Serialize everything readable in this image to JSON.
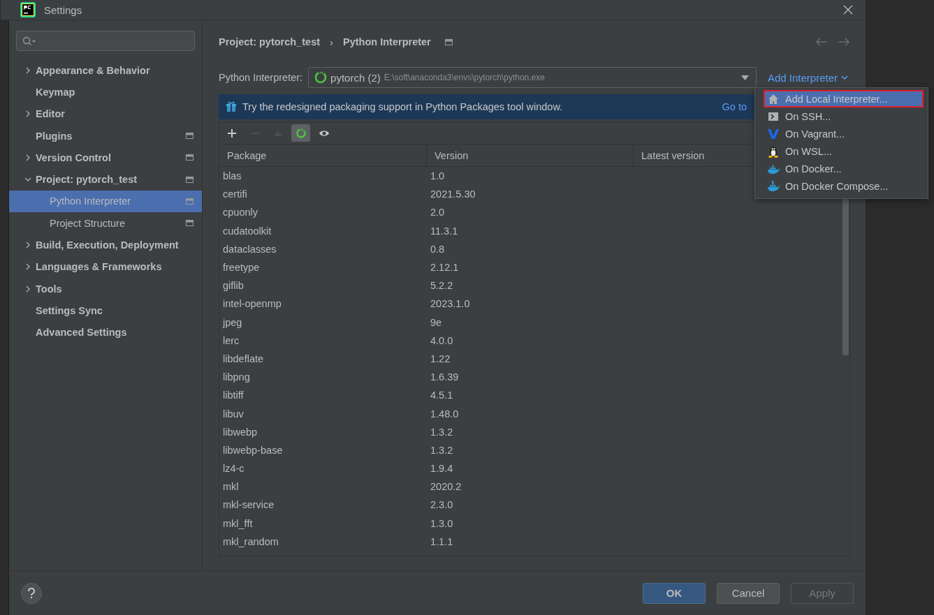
{
  "window": {
    "title": "Settings"
  },
  "sidebar": {
    "items": [
      {
        "label": "Appearance & Behavior",
        "kind": "group",
        "expanded": false,
        "selected": false,
        "project_scope": false
      },
      {
        "label": "Keymap",
        "kind": "leaf",
        "selected": false,
        "project_scope": false
      },
      {
        "label": "Editor",
        "kind": "group",
        "expanded": false,
        "selected": false,
        "project_scope": false
      },
      {
        "label": "Plugins",
        "kind": "leaf",
        "selected": false,
        "project_scope": true
      },
      {
        "label": "Version Control",
        "kind": "group",
        "expanded": false,
        "selected": false,
        "project_scope": true
      },
      {
        "label": "Project: pytorch_test",
        "kind": "group",
        "expanded": true,
        "selected": false,
        "project_scope": true,
        "children": [
          {
            "label": "Python Interpreter",
            "selected": true,
            "project_scope": true
          },
          {
            "label": "Project Structure",
            "selected": false,
            "project_scope": true
          }
        ]
      },
      {
        "label": "Build, Execution, Deployment",
        "kind": "group",
        "expanded": false,
        "selected": false,
        "project_scope": false
      },
      {
        "label": "Languages & Frameworks",
        "kind": "group",
        "expanded": false,
        "selected": false,
        "project_scope": false
      },
      {
        "label": "Tools",
        "kind": "group",
        "expanded": false,
        "selected": false,
        "project_scope": false
      },
      {
        "label": "Settings Sync",
        "kind": "leaf",
        "selected": false,
        "project_scope": false
      },
      {
        "label": "Advanced Settings",
        "kind": "leaf",
        "selected": false,
        "project_scope": false
      }
    ]
  },
  "breadcrumb": [
    "Project: pytorch_test",
    "Python Interpreter"
  ],
  "breadcrumb_separator": "›",
  "interpreter": {
    "label": "Python Interpreter:",
    "name": "pytorch (2)",
    "path": "E:\\soft\\anaconda3\\envs\\pytorch\\python.exe",
    "add_link": "Add Interpreter"
  },
  "banner": {
    "text": "Try the redesigned packaging support in Python Packages tool window.",
    "link": "Go to"
  },
  "toolbar": [
    {
      "kind": "add",
      "disabled": false,
      "pressed": false
    },
    {
      "kind": "remove",
      "disabled": true,
      "pressed": false
    },
    {
      "kind": "upgrade",
      "disabled": true,
      "pressed": false
    },
    {
      "kind": "conda",
      "disabled": false,
      "pressed": true
    },
    {
      "kind": "show",
      "disabled": false,
      "pressed": false
    }
  ],
  "table": {
    "columns": [
      "Package",
      "Version",
      "Latest version"
    ],
    "rows": [
      [
        "blas",
        "1.0"
      ],
      [
        "certifi",
        "2021.5.30"
      ],
      [
        "cpuonly",
        "2.0"
      ],
      [
        "cudatoolkit",
        "11.3.1"
      ],
      [
        "dataclasses",
        "0.8"
      ],
      [
        "freetype",
        "2.12.1"
      ],
      [
        "giflib",
        "5.2.2"
      ],
      [
        "intel-openmp",
        "2023.1.0"
      ],
      [
        "jpeg",
        "9e"
      ],
      [
        "lerc",
        "4.0.0"
      ],
      [
        "libdeflate",
        "1.22"
      ],
      [
        "libpng",
        "1.6.39"
      ],
      [
        "libtiff",
        "4.5.1"
      ],
      [
        "libuv",
        "1.48.0"
      ],
      [
        "libwebp",
        "1.3.2"
      ],
      [
        "libwebp-base",
        "1.3.2"
      ],
      [
        "lz4-c",
        "1.9.4"
      ],
      [
        "mkl",
        "2020.2"
      ],
      [
        "mkl-service",
        "2.3.0"
      ],
      [
        "mkl_fft",
        "1.3.0"
      ],
      [
        "mkl_random",
        "1.1.1"
      ]
    ]
  },
  "popup_menu": {
    "items": [
      {
        "label": "Add Local Interpreter...",
        "kind": "home",
        "selected": true
      },
      {
        "label": "On SSH...",
        "kind": "ssh",
        "selected": false
      },
      {
        "label": "On Vagrant...",
        "kind": "vagrant",
        "selected": false
      },
      {
        "label": "On WSL...",
        "kind": "wsl",
        "selected": false
      },
      {
        "label": "On Docker...",
        "kind": "docker",
        "selected": false
      },
      {
        "label": "On Docker Compose...",
        "kind": "compose",
        "selected": false
      }
    ]
  },
  "buttons": [
    {
      "label": "OK",
      "kind": "default",
      "disabled": false
    },
    {
      "label": "Cancel",
      "kind": "normal",
      "disabled": false
    },
    {
      "label": "Apply",
      "kind": "normal",
      "disabled": true
    }
  ]
}
